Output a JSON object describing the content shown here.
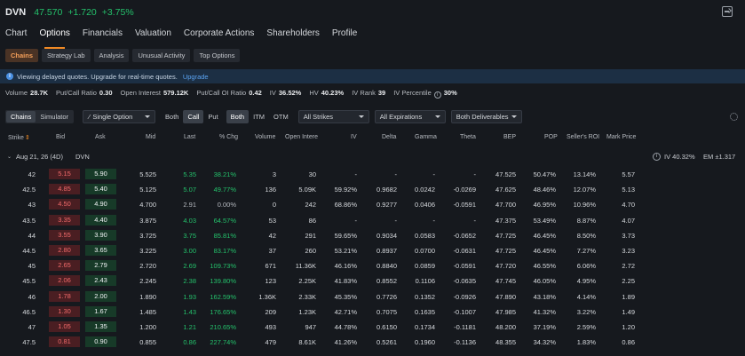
{
  "header": {
    "ticker": "DVN",
    "price": "47.570",
    "change": "+1.720",
    "change_pct": "+3.75%"
  },
  "nav_tabs": [
    "Chart",
    "Options",
    "Financials",
    "Valuation",
    "Corporate Actions",
    "Shareholders",
    "Profile"
  ],
  "sub_tabs": [
    "Chains",
    "Strategy Lab",
    "Analysis",
    "Unusual Activity",
    "Top Options"
  ],
  "banner": {
    "text": "Viewing delayed quotes. Upgrade for real-time quotes.",
    "link": "Upgrade"
  },
  "stats": {
    "volume_label": "Volume",
    "volume": "28.7K",
    "pcr_label": "Put/Call Ratio",
    "pcr": "0.30",
    "oi_label": "Open Interest",
    "oi": "579.12K",
    "pcoi_label": "Put/Call OI Ratio",
    "pcoi": "0.42",
    "iv_label": "IV",
    "iv": "36.52%",
    "hv_label": "HV",
    "hv": "40.23%",
    "ivrank_label": "IV Rank",
    "ivrank": "39",
    "ivpct_label": "IV Percentile",
    "ivpct": "30%"
  },
  "controls": {
    "view_chains": "Chains",
    "view_sim": "Simulator",
    "single_option": "Single Option",
    "both1": "Both",
    "call": "Call",
    "put": "Put",
    "both2": "Both",
    "itm": "ITM",
    "otm": "OTM",
    "strikes": "All Strikes",
    "expirations": "All Expirations",
    "deliverables": "Both Deliverables"
  },
  "columns": [
    "Strike",
    "Bid",
    "Ask",
    "Mid",
    "Last",
    "% Chg",
    "Volume",
    "Open Intere",
    "IV",
    "Delta",
    "Gamma",
    "Theta",
    "BEP",
    "POP",
    "Seller's ROI",
    "Mark Price"
  ],
  "expiry": {
    "label": "Aug 21, 26 (4D)",
    "symbol": "DVN",
    "iv": "IV 40.32%",
    "em": "EM ±1.317"
  },
  "rows": [
    {
      "strike": "42",
      "bid": "5.15",
      "ask": "5.90",
      "mid": "5.525",
      "last": "5.35",
      "pct": "38.21%",
      "vol": "3",
      "oi": "30",
      "iv": "-",
      "delta": "-",
      "gamma": "-",
      "theta": "-",
      "bep": "47.525",
      "pop": "50.47%",
      "roi": "13.14%",
      "mark": "5.57",
      "neutral": false
    },
    {
      "strike": "42.5",
      "bid": "4.85",
      "ask": "5.40",
      "mid": "5.125",
      "last": "5.07",
      "pct": "49.77%",
      "vol": "136",
      "oi": "5.09K",
      "iv": "59.92%",
      "delta": "0.9682",
      "gamma": "0.0242",
      "theta": "-0.0269",
      "bep": "47.625",
      "pop": "48.46%",
      "roi": "12.07%",
      "mark": "5.13",
      "neutral": false
    },
    {
      "strike": "43",
      "bid": "4.50",
      "ask": "4.90",
      "mid": "4.700",
      "last": "2.91",
      "pct": "0.00%",
      "vol": "0",
      "oi": "242",
      "iv": "68.86%",
      "delta": "0.9277",
      "gamma": "0.0406",
      "theta": "-0.0591",
      "bep": "47.700",
      "pop": "46.95%",
      "roi": "10.96%",
      "mark": "4.70",
      "neutral": true
    },
    {
      "strike": "43.5",
      "bid": "3.35",
      "ask": "4.40",
      "mid": "3.875",
      "last": "4.03",
      "pct": "64.57%",
      "vol": "53",
      "oi": "86",
      "iv": "-",
      "delta": "-",
      "gamma": "-",
      "theta": "-",
      "bep": "47.375",
      "pop": "53.49%",
      "roi": "8.87%",
      "mark": "4.07",
      "neutral": false
    },
    {
      "strike": "44",
      "bid": "3.55",
      "ask": "3.90",
      "mid": "3.725",
      "last": "3.75",
      "pct": "85.81%",
      "vol": "42",
      "oi": "291",
      "iv": "59.65%",
      "delta": "0.9034",
      "gamma": "0.0583",
      "theta": "-0.0652",
      "bep": "47.725",
      "pop": "46.45%",
      "roi": "8.50%",
      "mark": "3.73",
      "neutral": false
    },
    {
      "strike": "44.5",
      "bid": "2.80",
      "ask": "3.65",
      "mid": "3.225",
      "last": "3.00",
      "pct": "83.17%",
      "vol": "37",
      "oi": "260",
      "iv": "53.21%",
      "delta": "0.8937",
      "gamma": "0.0700",
      "theta": "-0.0631",
      "bep": "47.725",
      "pop": "46.45%",
      "roi": "7.27%",
      "mark": "3.23",
      "neutral": false
    },
    {
      "strike": "45",
      "bid": "2.65",
      "ask": "2.79",
      "mid": "2.720",
      "last": "2.69",
      "pct": "109.73%",
      "vol": "671",
      "oi": "11.36K",
      "iv": "46.16%",
      "delta": "0.8840",
      "gamma": "0.0859",
      "theta": "-0.0591",
      "bep": "47.720",
      "pop": "46.55%",
      "roi": "6.06%",
      "mark": "2.72",
      "neutral": false
    },
    {
      "strike": "45.5",
      "bid": "2.06",
      "ask": "2.43",
      "mid": "2.245",
      "last": "2.38",
      "pct": "139.80%",
      "vol": "123",
      "oi": "2.25K",
      "iv": "41.83%",
      "delta": "0.8552",
      "gamma": "0.1106",
      "theta": "-0.0635",
      "bep": "47.745",
      "pop": "46.05%",
      "roi": "4.95%",
      "mark": "2.25",
      "neutral": false
    },
    {
      "strike": "46",
      "bid": "1.78",
      "ask": "2.00",
      "mid": "1.890",
      "last": "1.93",
      "pct": "162.59%",
      "vol": "1.36K",
      "oi": "2.33K",
      "iv": "45.35%",
      "delta": "0.7726",
      "gamma": "0.1352",
      "theta": "-0.0926",
      "bep": "47.890",
      "pop": "43.18%",
      "roi": "4.14%",
      "mark": "1.89",
      "neutral": false
    },
    {
      "strike": "46.5",
      "bid": "1.30",
      "ask": "1.67",
      "mid": "1.485",
      "last": "1.43",
      "pct": "176.65%",
      "vol": "209",
      "oi": "1.23K",
      "iv": "42.71%",
      "delta": "0.7075",
      "gamma": "0.1635",
      "theta": "-0.1007",
      "bep": "47.985",
      "pop": "41.32%",
      "roi": "3.22%",
      "mark": "1.49",
      "neutral": false
    },
    {
      "strike": "47",
      "bid": "1.05",
      "ask": "1.35",
      "mid": "1.200",
      "last": "1.21",
      "pct": "210.65%",
      "vol": "493",
      "oi": "947",
      "iv": "44.78%",
      "delta": "0.6150",
      "gamma": "0.1734",
      "theta": "-0.1181",
      "bep": "48.200",
      "pop": "37.19%",
      "roi": "2.59%",
      "mark": "1.20",
      "neutral": false
    },
    {
      "strike": "47.5",
      "bid": "0.81",
      "ask": "0.90",
      "mid": "0.855",
      "last": "0.86",
      "pct": "227.74%",
      "vol": "479",
      "oi": "8.61K",
      "iv": "41.26%",
      "delta": "0.5261",
      "gamma": "0.1960",
      "theta": "-0.1136",
      "bep": "48.355",
      "pop": "34.32%",
      "roi": "1.83%",
      "mark": "0.86",
      "neutral": false
    }
  ]
}
